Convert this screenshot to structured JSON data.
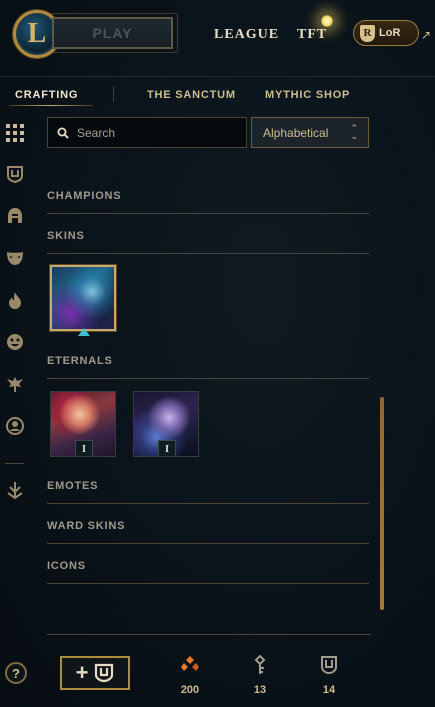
{
  "header": {
    "logo_letter": "L",
    "play_label": "PLAY",
    "nav": [
      "LEAGUE",
      "TFT"
    ],
    "lor_label": "LoR",
    "external_icon": "↗"
  },
  "subnav": {
    "tabs": [
      {
        "label": "CRAFTING",
        "active": true
      },
      {
        "label": "THE SANCTUM",
        "active": false
      },
      {
        "label": "MYTHIC SHOP",
        "active": false
      }
    ]
  },
  "rail": {
    "icons": [
      "grid-icon",
      "chest-icon",
      "helmet-icon",
      "mask-icon",
      "flame-icon",
      "emote-face-icon",
      "ward-icon",
      "profile-icon",
      "rune-icon"
    ],
    "help_label": "?"
  },
  "search": {
    "placeholder": "Search",
    "sort_selected": "Alphabetical"
  },
  "sections": {
    "champions": "CHAMPIONS",
    "skins": "SKINS",
    "eternals": "ETERNALS",
    "emotes": "EMOTES",
    "ward_skins": "WARD SKINS",
    "icons": "ICONS"
  },
  "eternal_tiers": [
    "I",
    "I"
  ],
  "bottom": {
    "add_plus": "+",
    "currencies": [
      {
        "icon": "orange-essence-icon",
        "value": "200"
      },
      {
        "icon": "key-icon",
        "value": "13"
      },
      {
        "icon": "chest-icon",
        "value": "14"
      }
    ]
  },
  "colors": {
    "gold": "#c8aa6e",
    "text": "#cdbe91",
    "background": "#0a1117",
    "orange_essence": "#e8782a",
    "selection_marker": "#3ec2d2"
  }
}
